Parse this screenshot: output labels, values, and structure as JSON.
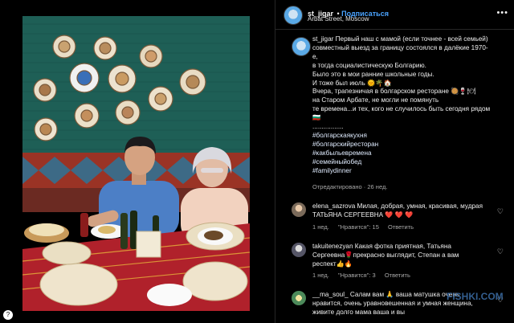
{
  "post": {
    "username": "st_jigar",
    "follow_label": "Подписаться",
    "location": "Arbat Street, Moscow",
    "more": "•••",
    "caption_lines": [
      "st_jigar Первый наш с мамой (если точнее - всей семьей)",
      "совместный выезд за границу состоялся в далёкие 1970-",
      "е,",
      "в тогда социалистическую Болгарию.",
      "Было это в мои ранние школьные годы.",
      "И тоже был июль 🌞🌴🏠",
      "Вчера, трапезничая в болгарском ресторане 🥘🍷🍽",
      "на Старом Арбате, не могли не помянуть",
      "те времена...и тех, кого не случилось быть сегодня рядом",
      "🇧🇬",
      ".................",
      "#болгарскаякухня",
      "#болгарскийресторан",
      "#какбыльевремена",
      "#семейныйобед",
      "#familydinner"
    ],
    "edited": "Отредактировано · 26 нед."
  },
  "comments": [
    {
      "username": "elena_sazrova",
      "text_lines": [
        "elena_sazrova Милая, добрая, умная, красивая, мудрая",
        "ТАТЬЯНА СЕРГЕЕВНА ❤️ ❤️ ❤️"
      ],
      "age": "1 нед.",
      "likes": "\"Нравится\": 15",
      "reply": "Ответить"
    },
    {
      "username": "takuitenezyan",
      "text_lines": [
        "takuitenezyan Какая фотка приятная, Татьяна",
        "Сергеевна🌹прекрасно выглядит, Степан а вам",
        "респект👍🔥"
      ],
      "age": "1 нед.",
      "likes": "\"Нравится\": 3",
      "reply": "Ответить"
    },
    {
      "username": "_ma_soul_",
      "text_lines": [
        "__ma_soul_ Салам вам 🙏 ваша матушка очень",
        "нравится, очень уравновешенная и умная женщина,",
        "живите долго мама ваша и вы"
      ],
      "age": "",
      "likes": "",
      "reply": ""
    }
  ],
  "watermark": "FISHKI.COM",
  "colors": {
    "background": "#000000",
    "accent": "#4aa3ff",
    "wall_green": "#1e5f56",
    "tablecloth_red": "#b0212b"
  }
}
